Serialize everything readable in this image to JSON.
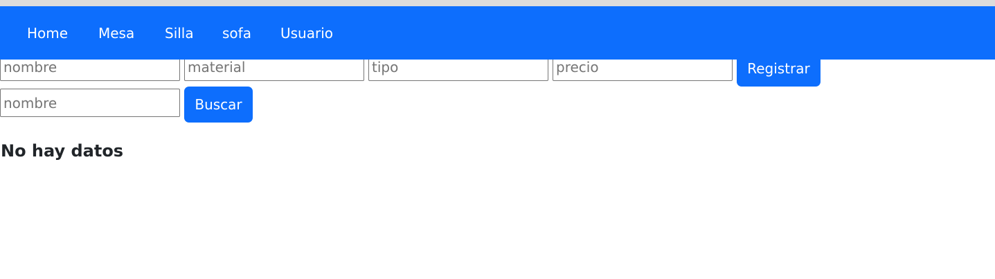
{
  "nav": {
    "items": [
      {
        "label": "Home"
      },
      {
        "label": "Mesa"
      },
      {
        "label": "Silla"
      },
      {
        "label": "sofa"
      },
      {
        "label": "Usuario"
      }
    ]
  },
  "register_form": {
    "nombre_placeholder": "nombre",
    "material_placeholder": "material",
    "tipo_placeholder": "tipo",
    "precio_placeholder": "precio",
    "submit_label": "Registrar"
  },
  "search_form": {
    "nombre_placeholder": "nombre",
    "submit_label": "Buscar"
  },
  "results": {
    "empty_message": "No hay datos"
  },
  "colors": {
    "primary": "#0d6efd",
    "text": "#212529"
  }
}
